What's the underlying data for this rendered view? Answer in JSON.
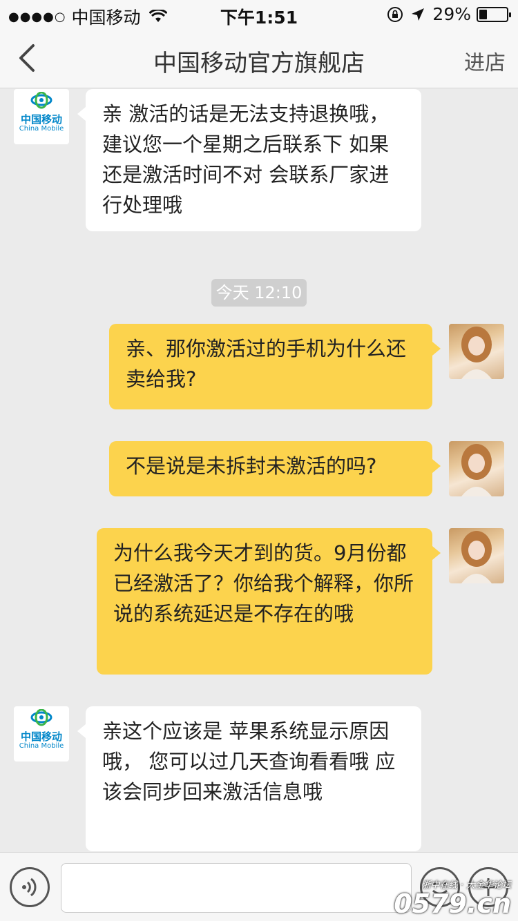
{
  "status_bar": {
    "signal": "●●●●○",
    "carrier": "中国移动",
    "time": "下午1:51",
    "battery_percent": "29%",
    "battery_level": 0.29
  },
  "nav": {
    "title": "中国移动官方旗舰店",
    "enter_store": "进店"
  },
  "store_avatar": {
    "name": "中国移动",
    "name_en": "China Mobile"
  },
  "messages": [
    {
      "from": "store",
      "text": "亲 激活的话是无法支持退换哦，  建议您一个星期之后联系下 如果还是激活时间不对  会联系厂家进行处理哦"
    },
    {
      "from": "user",
      "text": "亲、那你激活过的手机为什么还卖给我?"
    },
    {
      "from": "user",
      "text": "不是说是未拆封未激活的吗?"
    },
    {
      "from": "user",
      "text": "为什么我今天才到的货。9月份都已经激活了？你给我个解释，你所说的系统延迟是不存在的哦"
    },
    {
      "from": "store",
      "text": "亲这个应该是 苹果系统显示原因哦，  您可以过几天查询看看哦      应该会同步回来激活信息哦"
    }
  ],
  "timestamp": "今天 12:10",
  "watermark": {
    "top": "浙中在线 · 大金华论坛",
    "big": "0579.cn"
  },
  "colors": {
    "outgoing_bubble": "#fcd34d",
    "incoming_bubble": "#ffffff",
    "background": "#ebebeb",
    "brand_blue": "#0086c9"
  }
}
